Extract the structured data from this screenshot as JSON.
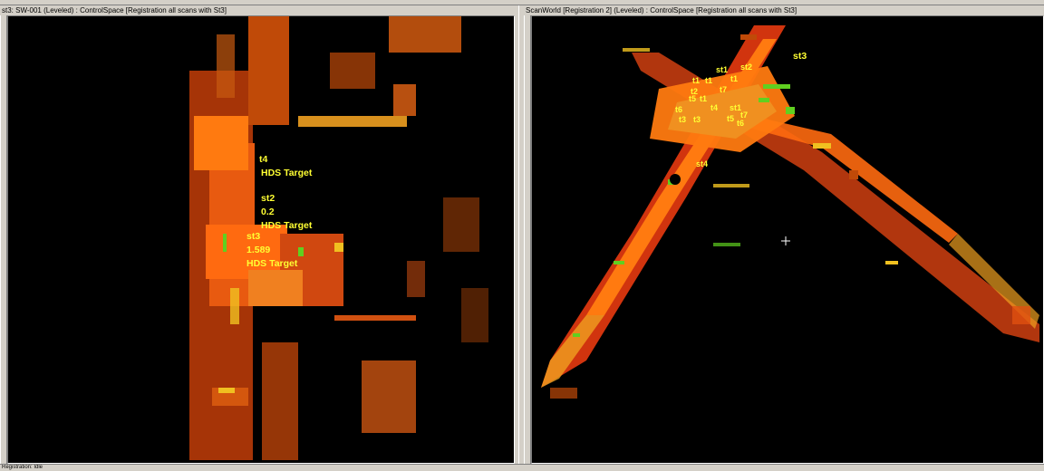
{
  "left_view": {
    "title": "st3: SW-001 (Leveled) : ControlSpace [Registration all scans with St3]",
    "labels": [
      "t4",
      "HDS Target",
      "st2",
      "0.2",
      "HDS Target",
      "st3",
      "1.589",
      "HDS Target"
    ]
  },
  "right_view": {
    "title": "ScanWorld [Registration 2] (Leveled) : ControlSpace [Registration all scans with St3]",
    "labels": [
      "st3",
      "st2",
      "st1",
      "t1",
      "t1",
      "t1",
      "t2",
      "t7",
      "t5",
      "t4",
      "t3",
      "t3",
      "st1",
      "t5",
      "t7",
      "t6",
      "st4",
      "t6",
      "t1"
    ]
  },
  "status_bar": {
    "text": "Registration: Idle"
  },
  "colors": {
    "cloud_red": "#e83a10",
    "cloud_orange": "#ff7a10",
    "cloud_yellow": "#f0c020",
    "cloud_green": "#60d020",
    "label": "#ffff33"
  }
}
